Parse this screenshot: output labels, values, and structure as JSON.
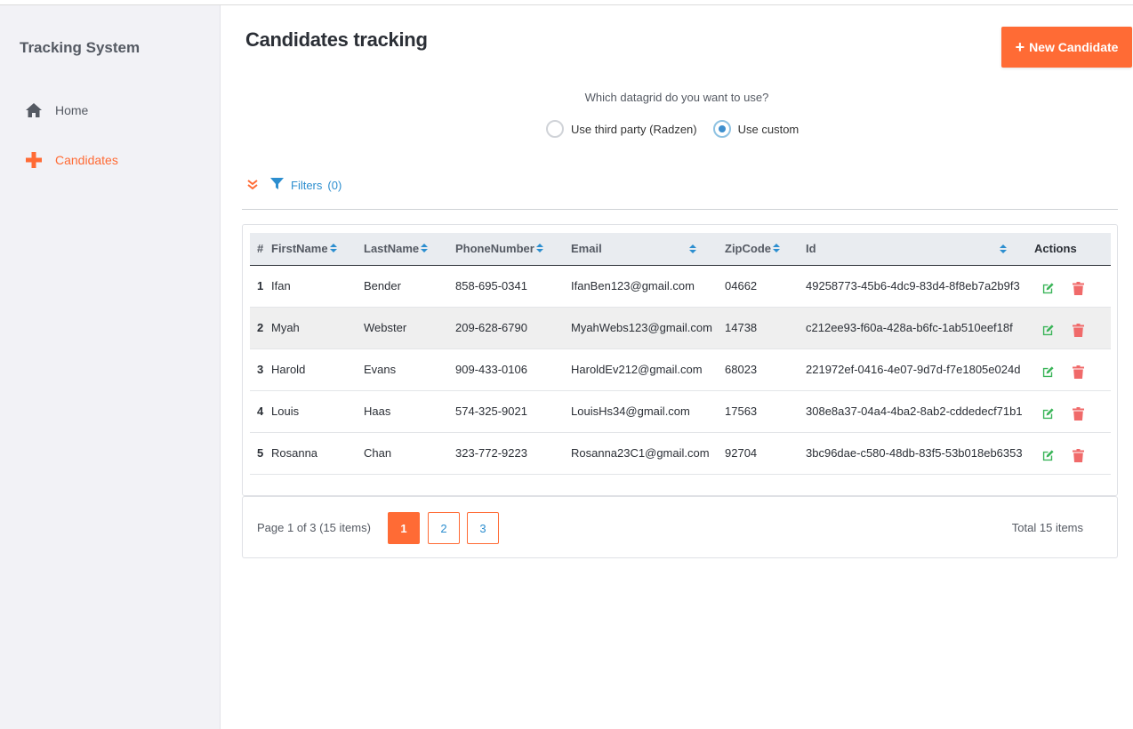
{
  "app": {
    "brand": "Tracking System"
  },
  "sidebar": {
    "items": [
      {
        "label": "Home",
        "icon": "home-icon",
        "active": false
      },
      {
        "label": "Candidates",
        "icon": "plus-icon",
        "active": true
      }
    ]
  },
  "header": {
    "title": "Candidates tracking",
    "new_button": "New Candidate"
  },
  "datagrid_choice": {
    "question": "Which datagrid do you want to use?",
    "options": [
      {
        "label": "Use third party (Radzen)",
        "checked": false
      },
      {
        "label": "Use custom",
        "checked": true
      }
    ]
  },
  "filters": {
    "label": "Filters",
    "count": "(0)"
  },
  "table": {
    "columns": [
      "#",
      "FirstName",
      "LastName",
      "PhoneNumber",
      "Email",
      "ZipCode",
      "Id",
      "Actions"
    ],
    "rows": [
      {
        "n": "1",
        "first": "Ifan",
        "last": "Bender",
        "phone": "858-695-0341",
        "email": "IfanBen123@gmail.com",
        "zip": "04662",
        "id": "49258773-45b6-4dc9-83d4-8f8eb7a2b9f3"
      },
      {
        "n": "2",
        "first": "Myah",
        "last": "Webster",
        "phone": "209-628-6790",
        "email": "MyahWebs123@gmail.com",
        "zip": "14738",
        "id": "c212ee93-f60a-428a-b6fc-1ab510eef18f"
      },
      {
        "n": "3",
        "first": "Harold",
        "last": "Evans",
        "phone": "909-433-0106",
        "email": "HaroldEv212@gmail.com",
        "zip": "68023",
        "id": "221972ef-0416-4e07-9d7d-f7e1805e024d"
      },
      {
        "n": "4",
        "first": "Louis",
        "last": "Haas",
        "phone": "574-325-9021",
        "email": "LouisHs34@gmail.com",
        "zip": "17563",
        "id": "308e8a37-04a4-4ba2-8ab2-cddedecf71b1"
      },
      {
        "n": "5",
        "first": "Rosanna",
        "last": "Chan",
        "phone": "323-772-9223",
        "email": "Rosanna23C1@gmail.com",
        "zip": "92704",
        "id": "3bc96dae-c580-48db-83f5-53b018eb6353"
      }
    ]
  },
  "pager": {
    "info": "Page 1 of 3 (15 items)",
    "pages": [
      "1",
      "2",
      "3"
    ],
    "current": "1",
    "total": "Total 15 items"
  },
  "colors": {
    "accent": "#ff6b35",
    "link": "#2c8ecf",
    "edit": "#3cb55a",
    "delete": "#f06a6a"
  }
}
